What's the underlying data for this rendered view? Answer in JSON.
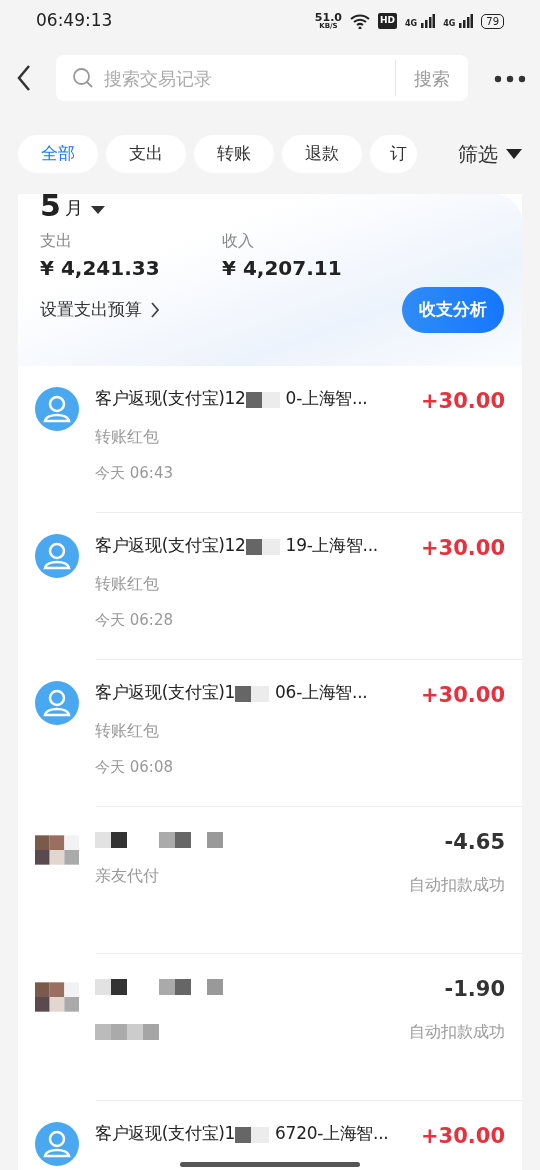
{
  "status_bar": {
    "time": "06:49:13",
    "speed": "51.0",
    "speed_unit": "KB/S",
    "hd": "HD",
    "networks": [
      "4G",
      "4G"
    ],
    "battery": "79"
  },
  "search": {
    "placeholder": "搜索交易记录",
    "button": "搜索"
  },
  "filters": [
    {
      "label": "全部",
      "selected": true
    },
    {
      "label": "支出",
      "selected": false
    },
    {
      "label": "转账",
      "selected": false
    },
    {
      "label": "退款",
      "selected": false
    },
    {
      "label": "订",
      "selected": false
    }
  ],
  "filter_button": "筛选",
  "summary": {
    "month_number": "5",
    "month_unit": "月",
    "expense_label": "支出",
    "expense": "¥ 4,241.33",
    "income_label": "收入",
    "income": "¥ 4,207.11",
    "budget_link": "设置支出预算",
    "analysis_button": "收支分析"
  },
  "transactions": [
    {
      "kind": "contact",
      "title_start": "客户返现(支付宝)12",
      "title_end": "0-上海智...",
      "subtitle": "转账红包",
      "time": "今天 06:43",
      "amount": "+30.00",
      "income": true
    },
    {
      "kind": "contact",
      "title_start": "客户返现(支付宝)12",
      "title_end": "19-上海智...",
      "subtitle": "转账红包",
      "time": "今天 06:28",
      "amount": "+30.00",
      "income": true
    },
    {
      "kind": "contact",
      "title_start": "客户返现(支付宝)1",
      "title_end": "06-上海智...",
      "subtitle": "转账红包",
      "time": "今天 06:08",
      "amount": "+30.00",
      "income": true
    },
    {
      "kind": "masked",
      "subtitle": "亲友代付",
      "amount": "-4.65",
      "status": "自动扣款成功",
      "income": false
    },
    {
      "kind": "masked",
      "amount": "-1.90",
      "status": "自动扣款成功",
      "income": false
    },
    {
      "kind": "contact",
      "title_start": "客户返现(支付宝)1",
      "title_end": "6720-上海智...",
      "amount": "+30.00",
      "income": true
    }
  ]
}
